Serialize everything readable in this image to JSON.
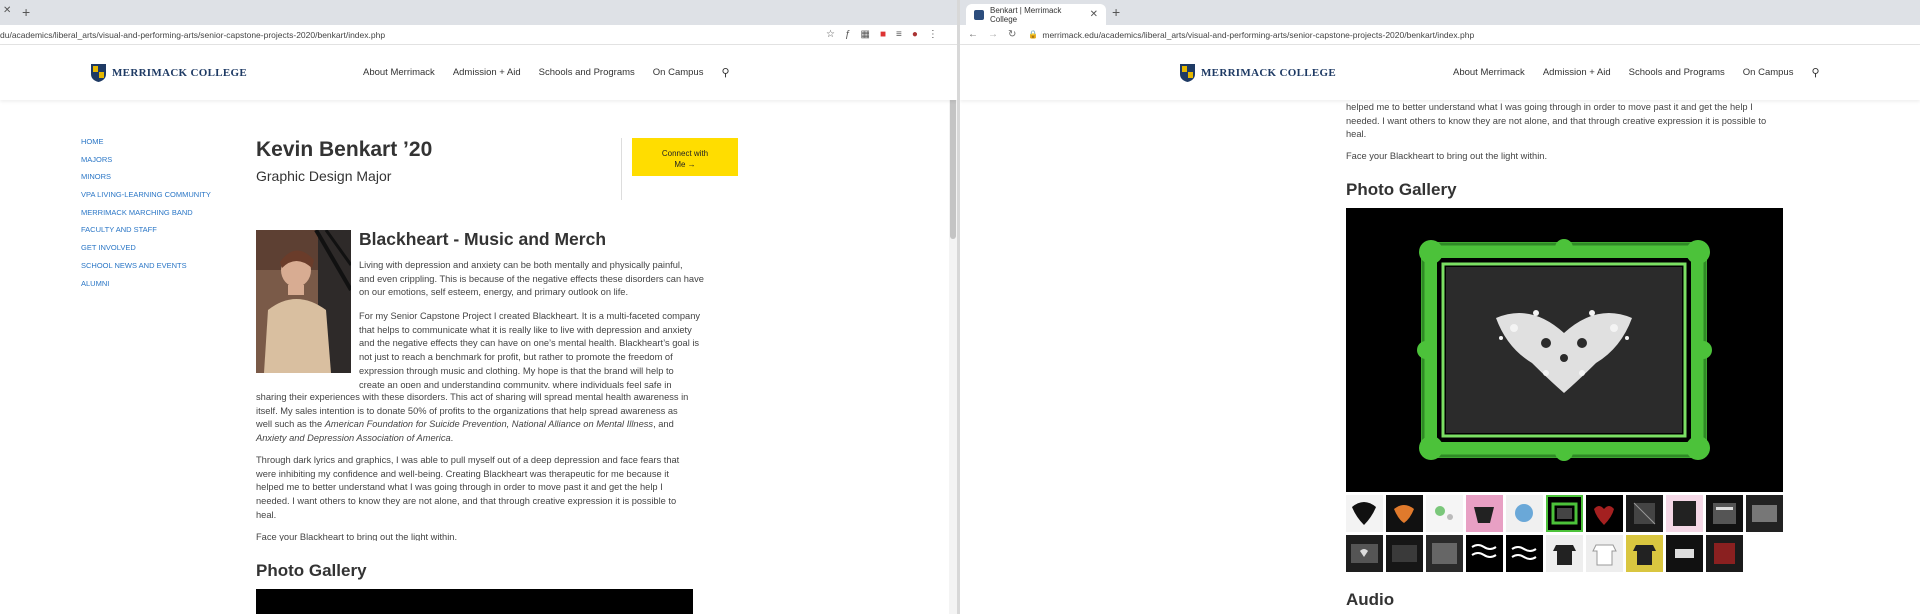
{
  "left_window": {
    "address_url": "du/academics/liberal_arts/visual-and-performing-arts/senior-capstone-projects-2020/benkart/index.php"
  },
  "right_window": {
    "tab_title": "Benkart | Merrimack College",
    "address_url": "merrimack.edu/academics/liberal_arts/visual-and-performing-arts/senior-capstone-projects-2020/benkart/index.php"
  },
  "site": {
    "logo_text": "MERRIMACK COLLEGE",
    "nav": [
      "About Merrimack",
      "Admission + Aid",
      "Schools and Programs",
      "On Campus"
    ]
  },
  "sidebar": {
    "items": [
      "HOME",
      "MAJORS",
      "MINORS",
      "VPA LIVING-LEARNING COMMUNITY",
      "MERRIMACK MARCHING BAND",
      "FACULTY AND STAFF",
      "GET INVOLVED",
      "SCHOOL NEWS AND EVENTS",
      "ALUMNI"
    ]
  },
  "profile": {
    "name": "Kevin Benkart ’20",
    "major": "Graphic Design Major",
    "connect_line1": "Connect with",
    "connect_line2": "Me →"
  },
  "project": {
    "title": "Blackheart - Music and Merch",
    "p1_l1": "Living with depression and anxiety can be both mentally and physically painful,",
    "p1_l2": "and even crippling. This is because of the negative effects these disorders can have",
    "p1_l3": "on our emotions, self esteem, energy, and primary outlook on life.",
    "p2_l1": "For my Senior Capstone Project I created Blackheart. It is a multi-faceted company",
    "p2_l2": "that helps to communicate what it is really like to live with depression and anxiety",
    "p2_l3": "and the negative effects they can have on one’s mental health. Blackheart’s goal is",
    "p2_l4": "not just to reach a benchmark for profit, but rather to promote the freedom of",
    "p2_l5": "expression through music and clothing. My hope is that the brand will help to",
    "p2_l6": "create an open and understanding community, where individuals feel safe in",
    "p2_l7": "sharing their experiences with these disorders. This act of sharing will spread mental health awareness in",
    "p2_l8": "itself. My sales intention is to donate 50% of profits to the organizations that help spread awareness as",
    "p2_l9_a": "well such as the ",
    "p2_l9_b": "American Foundation for Suicide Prevention, National Alliance on Mental Illness",
    "p2_l9_c": ", and",
    "p2_l10": "Anxiety and Depression Association of America",
    "p2_l10_end": ".",
    "p3_l1": "Through dark lyrics and graphics, I was able to pull myself out of a deep depression and face fears that",
    "p3_l2": "were inhibiting my confidence and well-being. Creating Blackheart was therapeutic for me because it",
    "p3_l3": "helped me to better understand what I was going through in order to move past it and get the help I",
    "p3_l4": "needed. I want others to know they are not alone, and that through creative expression it is possible to",
    "p3_l5": "heal.",
    "p4": "Face your Blackheart to bring out the light within."
  },
  "right_content": {
    "r_l1": "helped me to better understand what I was going through in order to move past it and get the help I",
    "r_l2": "needed. I want others to know they are not alone, and that through creative expression it is possible to",
    "r_l3": "heal.",
    "r_p4": "Face your Blackheart to bring out the light within.",
    "gallery_heading": "Photo Gallery",
    "audio_heading": "Audio"
  },
  "left_gallery_heading": "Photo Gallery",
  "colors": {
    "accent_yellow": "#ffdd00",
    "link_blue": "#2a76c6",
    "brand_navy": "#1e3a64",
    "frame_green": "#4cc23a"
  }
}
